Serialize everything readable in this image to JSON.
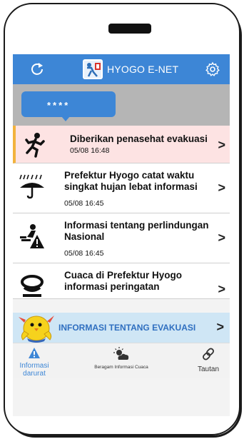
{
  "header": {
    "title": "HYOGO E-NET",
    "refresh_icon": "refresh-icon",
    "settings_icon": "gear-icon",
    "color": "#3d86d6"
  },
  "banner": {
    "text": "****"
  },
  "notifications": [
    {
      "title": "Diberikan penasehat evakuasi",
      "time": "05/08 16:48",
      "icon": "running-person-icon",
      "highlight": true
    },
    {
      "title": "Prefektur Hyogo catat waktu singkat hujan lebat informasi",
      "time": "05/08 16:45",
      "icon": "heavy-rain-umbrella-icon"
    },
    {
      "title": "Informasi tentang perlindungan Nasional",
      "time": "05/08 16:45",
      "icon": "civil-protection-warning-icon"
    },
    {
      "title": "Cuaca di Prefektur Hyogo informasi peringatan",
      "time": "",
      "icon": "typhoon-icon"
    }
  ],
  "evacuation_bar": {
    "label": "INFORMASI TENTANG EVAKUASI",
    "mascot": "bird-mascot-icon"
  },
  "tabs": [
    {
      "label": "Informasi darurat",
      "icon": "warning-icon",
      "active": true
    },
    {
      "label": "Beragam Informasi Cuaca",
      "icon": "weather-icon"
    },
    {
      "label": "Tautan",
      "icon": "link-icon"
    }
  ],
  "chevron": ">"
}
